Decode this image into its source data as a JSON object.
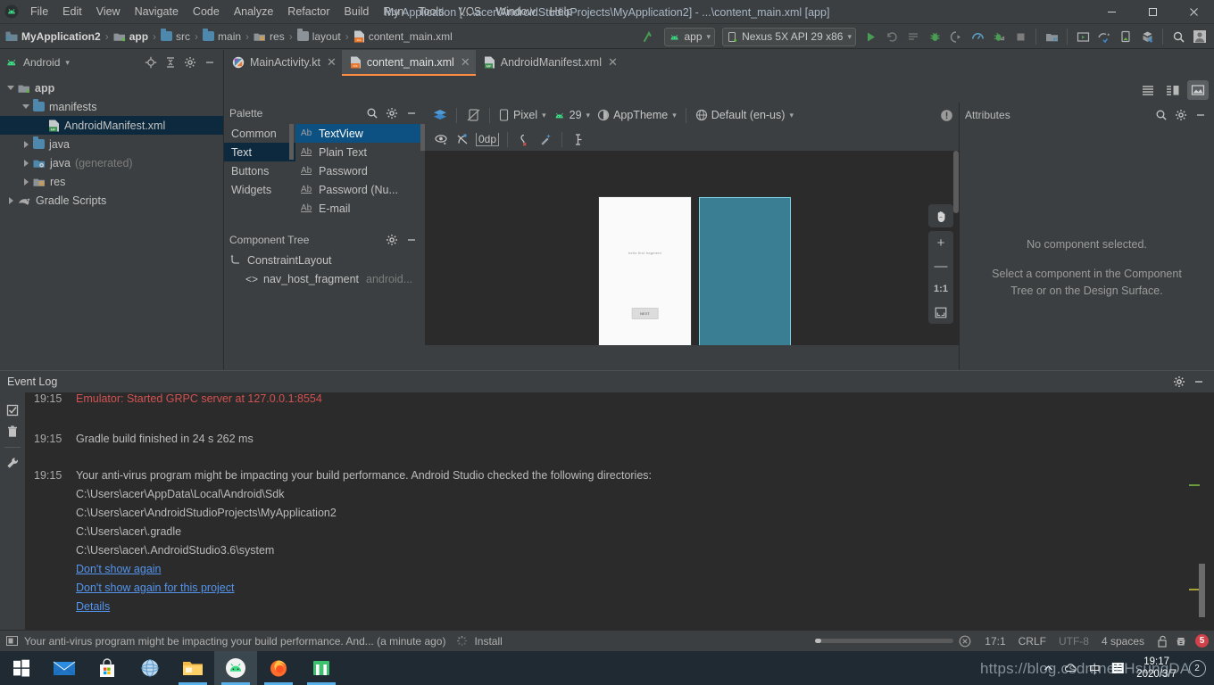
{
  "titlebar": {
    "app_icon": "android-studio-logo-icon",
    "menus": [
      "File",
      "Edit",
      "View",
      "Navigate",
      "Code",
      "Analyze",
      "Refactor",
      "Build",
      "Run",
      "Tools",
      "VCS",
      "Window",
      "Help"
    ],
    "window_title": "My Application [...\\acer\\AndroidStudioProjects\\MyApplication2] - ...\\content_main.xml [app]",
    "minimize": "—",
    "maximize": "❐",
    "close": "✕"
  },
  "breadcrumb": {
    "items": [
      {
        "label": "MyApplication2",
        "icon": "module-icon",
        "bold": true
      },
      {
        "label": "app",
        "icon": "module-icon",
        "bold": true
      },
      {
        "label": "src",
        "icon": "folder-icon",
        "bold": false
      },
      {
        "label": "main",
        "icon": "folder-icon",
        "bold": false
      },
      {
        "label": "res",
        "icon": "res-folder-icon",
        "bold": false
      },
      {
        "label": "layout",
        "icon": "folder-icon",
        "bold": false
      },
      {
        "label": "content_main.xml",
        "icon": "xml-layout-icon",
        "bold": false
      }
    ],
    "separator": "›"
  },
  "runbar": {
    "module_selector": "app",
    "device_selector": "Nexus 5X API 29 x86",
    "buttons": [
      "run-button",
      "rerun-button",
      "run-list-button",
      "debug-button",
      "attach-debugger-button",
      "profiler-button",
      "run-with-coverage-button",
      "stop-button",
      "sdk-manager-button",
      "avd-manager-button",
      "sync-gradle-button",
      "device-file-explorer-button",
      "layout-inspector-button",
      "search-everywhere-button",
      "user-account-button"
    ]
  },
  "project_panel": {
    "title": "Android",
    "actions": [
      "locate-icon",
      "collapse-all-icon",
      "settings-icon",
      "hide-icon"
    ],
    "tree": [
      {
        "label": "app",
        "icon": "module-icon",
        "indent": 0,
        "twisty": "open",
        "bold": true,
        "selected": false
      },
      {
        "label": "manifests",
        "icon": "folder-icon",
        "indent": 1,
        "twisty": "open",
        "bold": false,
        "selected": false
      },
      {
        "label": "AndroidManifest.xml",
        "icon": "manifest-icon",
        "indent": 2,
        "twisty": "none",
        "bold": false,
        "selected": true
      },
      {
        "label": "java",
        "icon": "folder-icon",
        "indent": 1,
        "twisty": "closed",
        "bold": false,
        "selected": false
      },
      {
        "label": "java",
        "suffix": "(generated)",
        "icon": "folder-generated-icon",
        "indent": 1,
        "twisty": "closed",
        "bold": false,
        "selected": false
      },
      {
        "label": "res",
        "icon": "res-folder-icon",
        "indent": 1,
        "twisty": "closed",
        "bold": false,
        "selected": false
      },
      {
        "label": "Gradle Scripts",
        "icon": "gradle-icon",
        "indent": 0,
        "twisty": "closed",
        "bold": false,
        "selected": false
      }
    ]
  },
  "editor_tabs": [
    {
      "label": "MainActivity.kt",
      "icon": "kotlin-file-icon",
      "active": false,
      "closable": true
    },
    {
      "label": "content_main.xml",
      "icon": "xml-layout-icon",
      "active": true,
      "closable": true
    },
    {
      "label": "AndroidManifest.xml",
      "icon": "manifest-icon",
      "active": false,
      "closable": true
    }
  ],
  "palette": {
    "title": "Palette",
    "actions": [
      "search-icon",
      "settings-icon",
      "hide-icon"
    ],
    "categories": [
      {
        "label": "Common",
        "selected": false
      },
      {
        "label": "Text",
        "selected": true
      },
      {
        "label": "Buttons",
        "selected": false
      },
      {
        "label": "Widgets",
        "selected": false
      }
    ],
    "items": [
      {
        "label": "TextView",
        "icon": "Ab",
        "selected": true
      },
      {
        "label": "Plain Text",
        "icon": "Ab",
        "selected": false
      },
      {
        "label": "Password",
        "icon": "Ab",
        "selected": false
      },
      {
        "label": "Password (Nu...",
        "icon": "Ab",
        "selected": false
      },
      {
        "label": "E-mail",
        "icon": "Ab",
        "selected": false
      }
    ]
  },
  "component_tree": {
    "title": "Component Tree",
    "actions": [
      "settings-icon",
      "hide-icon"
    ],
    "nodes": [
      {
        "label": "ConstraintLayout",
        "icon": "constraintlayout-icon",
        "indent": 0,
        "suffix": ""
      },
      {
        "label": "nav_host_fragment",
        "icon": "fragment-icon",
        "indent": 1,
        "suffix": "android..."
      }
    ]
  },
  "design_toolbar": {
    "design_mode_button": "design-surface-mode-icon",
    "orientation_button": "orientation-rotate-icon",
    "device": "Pixel",
    "api_level": "29",
    "theme": "AppTheme",
    "locale": "Default (en-us)",
    "warning_button": "issue-notification-icon",
    "row2": {
      "visibility_button": "show-constraints-icon",
      "autoconnect_button": "autoconnect-off-icon",
      "default_margin": "0dp",
      "clear_constraints_button": "clear-constraints-icon",
      "infer_constraints_button": "infer-constraints-icon",
      "guidelines_button": "guidelines-icon"
    }
  },
  "design_surface": {
    "preview_text": "hello first fragment",
    "preview_button": "NEXT",
    "blueprint_label": "",
    "zoom_controls": {
      "pan_button": "pan-hand-icon",
      "zoom_in": "+",
      "zoom_out": "—",
      "zoom_actual": "1:1",
      "zoom_fit": "zoom-to-fit-icon"
    }
  },
  "view_modes": {
    "buttons": [
      "code-mode-icon",
      "split-mode-icon",
      "design-mode-icon"
    ],
    "selected_index": 2
  },
  "attributes_panel": {
    "title": "Attributes",
    "actions": [
      "search-icon",
      "settings-icon",
      "hide-icon"
    ],
    "empty_title": "No component selected.",
    "empty_hint": "Select a component in the Component Tree or on the Design Surface."
  },
  "event_log": {
    "title": "Event Log",
    "actions": [
      "settings-icon",
      "hide-icon"
    ],
    "side_buttons": [
      "mark-read-icon",
      "delete-icon",
      "settings-wrench-icon"
    ],
    "entries": [
      {
        "time": "19:15",
        "text": "Emulator: Started GRPC server at 127.0.0.1:8554",
        "style": "error",
        "indent": false
      },
      {
        "time": "",
        "text": "",
        "style": "spacer",
        "indent": false
      },
      {
        "time": "19:15",
        "text": "Gradle build finished in 24 s 262 ms",
        "style": "normal",
        "indent": false
      },
      {
        "time": "",
        "text": "",
        "style": "spacer",
        "indent": false
      },
      {
        "time": "19:15",
        "text": "Your anti-virus program might be impacting your build performance. Android Studio checked the following directories:",
        "style": "normal",
        "indent": false
      },
      {
        "time": "",
        "text": "C:\\Users\\acer\\AppData\\Local\\Android\\Sdk",
        "style": "normal",
        "indent": true
      },
      {
        "time": "",
        "text": "C:\\Users\\acer\\AndroidStudioProjects\\MyApplication2",
        "style": "normal",
        "indent": true
      },
      {
        "time": "",
        "text": "C:\\Users\\acer\\.gradle",
        "style": "normal",
        "indent": true
      },
      {
        "time": "",
        "text": "C:\\Users\\acer\\.AndroidStudio3.6\\system",
        "style": "normal",
        "indent": true
      },
      {
        "time": "",
        "text": "Don't show again",
        "style": "link",
        "indent": true
      },
      {
        "time": "",
        "text": "Don't show again for this project",
        "style": "link",
        "indent": true
      },
      {
        "time": "",
        "text": "Details",
        "style": "link",
        "indent": true
      }
    ]
  },
  "statusbar": {
    "message": "Your anti-virus program might be impacting your build performance. And... (a minute ago)",
    "install_label": "Install",
    "caret_position": "17:1",
    "line_separator": "CRLF",
    "encoding": "UTF-8",
    "indent": "4 spaces",
    "lock_icon": "unlocked-icon",
    "inspector_icon": "hector-inspection-icon",
    "error_count": "5"
  },
  "taskbar": {
    "items": [
      {
        "name": "start-button",
        "active": false,
        "running": false
      },
      {
        "name": "mail-app",
        "active": false,
        "running": false
      },
      {
        "name": "microsoft-store-app",
        "active": false,
        "running": false
      },
      {
        "name": "internet-explorer-app",
        "active": false,
        "running": false
      },
      {
        "name": "file-explorer-app",
        "active": false,
        "running": true
      },
      {
        "name": "android-studio-app",
        "active": true,
        "running": true
      },
      {
        "name": "firefox-app",
        "active": false,
        "running": true
      },
      {
        "name": "app-window",
        "active": false,
        "running": true
      }
    ],
    "tray": {
      "ime_label": "中",
      "clock_time": "19:17",
      "clock_date": "2020/3/7",
      "notification_count": "2"
    },
    "watermark": "https://blog.csdn.net/HsungDA"
  },
  "colors": {
    "accent_orange": "#ff8c42",
    "selection_blue": "#0d293e",
    "link_blue": "#5394ec",
    "error_red": "#d25252",
    "blueprint_teal": "#3a7e94",
    "panel_bg": "#3c3f41",
    "editor_bg": "#2b2b2b"
  }
}
